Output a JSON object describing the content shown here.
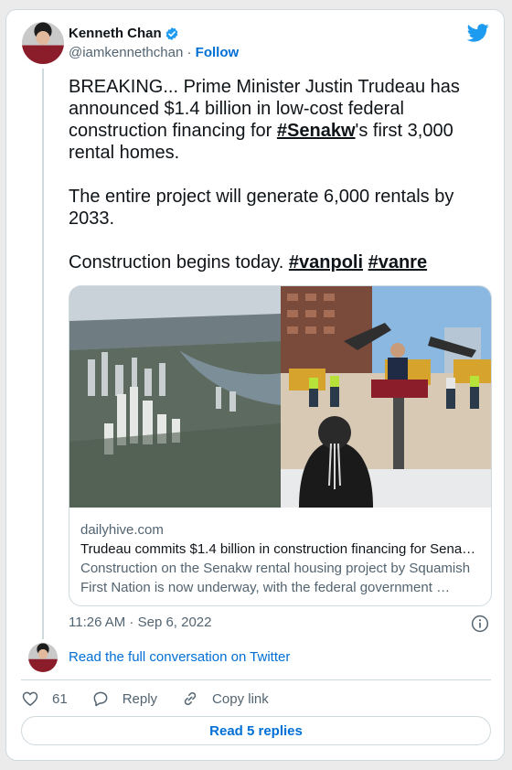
{
  "author": {
    "name": "Kenneth Chan",
    "handle": "@iamkennethchan",
    "separator": "·",
    "follow_label": "Follow"
  },
  "tweet": {
    "paragraph1_pre": "BREAKING... Prime Minister Justin Trudeau has announced $1.4 billion in low-cost federal construction financing for ",
    "hashtag_senakw": "#Senakw",
    "paragraph1_post": "'s first 3,000 rental homes.",
    "paragraph2": "The entire project will generate 6,000 rentals by 2033.",
    "paragraph3_pre": "Construction begins today. ",
    "hashtag_vanpoli": "#vanpoli",
    "space": " ",
    "hashtag_vanre": "#vanre"
  },
  "link_card": {
    "domain": "dailyhive.com",
    "title": "Trudeau commits $1.4 billion in construction financing for Sena…",
    "description": "Construction on the Senakw rental housing project by Squamish First Nation is now underway, with the federal government …"
  },
  "timestamp": "11:26 AM · Sep 6, 2022",
  "read_conversation_label": "Read the full conversation on Twitter",
  "actions": {
    "like_count": "61",
    "reply_label": "Reply",
    "copy_link_label": "Copy link"
  },
  "read_replies_label": "Read 5 replies",
  "colors": {
    "accent": "#006fd6",
    "twitter_blue": "#1d9bf0",
    "text": "#0f1419",
    "muted": "#536471"
  },
  "icons": [
    "verified-badge-icon",
    "twitter-bird-icon",
    "info-icon",
    "heart-icon",
    "reply-bubble-icon",
    "link-icon"
  ]
}
